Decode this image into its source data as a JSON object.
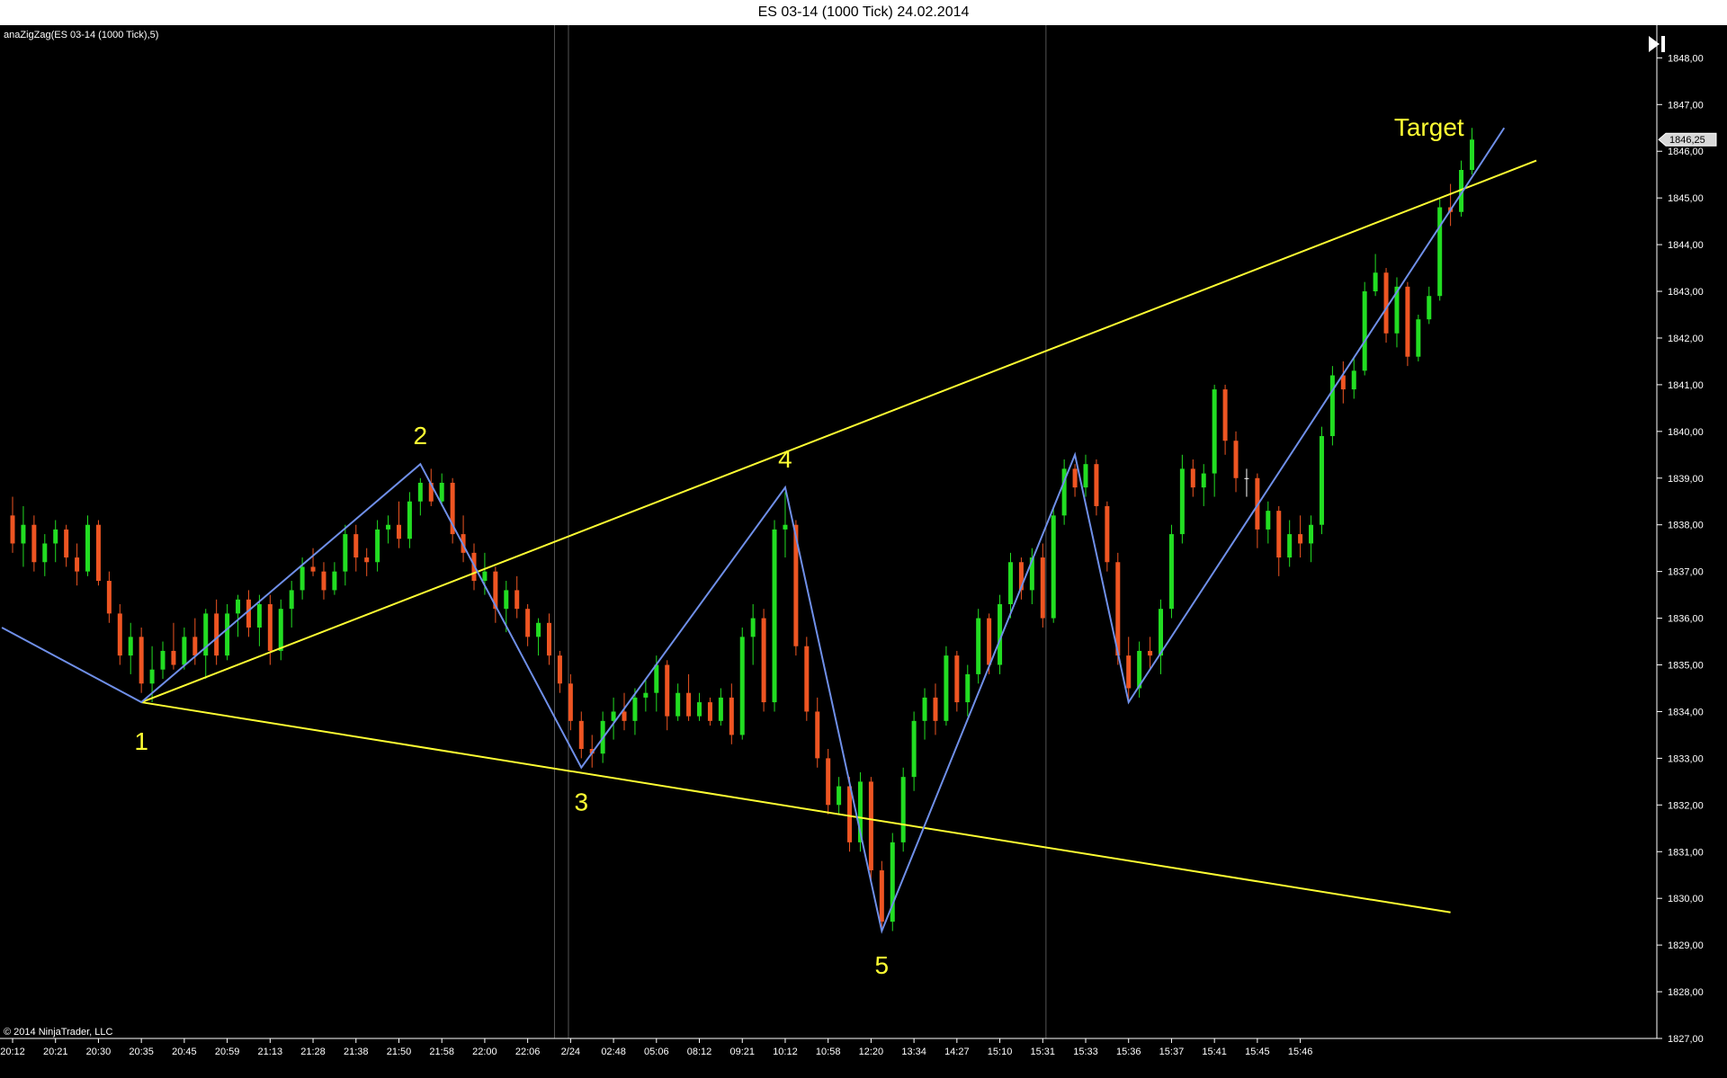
{
  "window": {
    "title": "ES 03-14 (1000 Tick)  24.02.2014"
  },
  "indicator_label": "anaZigZag(ES 03-14 (1000 Tick),5)",
  "copyright": "© 2014 NinjaTrader, LLC",
  "toolbar": {
    "end_icon": "skip-to-end-icon"
  },
  "colors": {
    "background": "#000000",
    "up_bar": "#22dd22",
    "down_bar": "#ee5522",
    "neutral_bar": "#ffffff",
    "zigzag": "#6f8fe8",
    "channel": "#ffff33",
    "label": "#ffff33",
    "axis_text": "#ffffff",
    "session_line": "#555555"
  },
  "chart_data": {
    "type": "candlestick",
    "instrument": "ES 03-14",
    "interval": "1000 Tick",
    "ylim": [
      1827,
      1848.7
    ],
    "y_ticks": [
      "1827,00",
      "1828,00",
      "1829,00",
      "1830,00",
      "1831,00",
      "1832,00",
      "1833,00",
      "1834,00",
      "1835,00",
      "1836,00",
      "1837,00",
      "1838,00",
      "1839,00",
      "1840,00",
      "1841,00",
      "1842,00",
      "1843,00",
      "1844,00",
      "1845,00",
      "1846,00",
      "1847,00",
      "1848,00"
    ],
    "x_ticks": [
      "20:12",
      "20:21",
      "20:30",
      "20:35",
      "20:45",
      "20:59",
      "21:13",
      "21:28",
      "21:38",
      "21:50",
      "21:58",
      "22:00",
      "22:06",
      "2/24",
      "02:48",
      "05:06",
      "08:12",
      "09:21",
      "10:12",
      "10:58",
      "12:20",
      "13:34",
      "14:27",
      "15:10",
      "15:31",
      "15:33",
      "15:36",
      "15:37",
      "15:41",
      "15:45",
      "15:46"
    ],
    "x_tick_bars": [
      0,
      4,
      8,
      12,
      16,
      20,
      24,
      28,
      32,
      36,
      40,
      44,
      48,
      52,
      56,
      60,
      64,
      68,
      72,
      76,
      80,
      84,
      88,
      92,
      96,
      100,
      104,
      108,
      112,
      116,
      120
    ],
    "session_breaks": [
      50.5,
      51.8,
      96.3
    ],
    "last_price": "1846,25",
    "bars": [
      {
        "o": 1838.2,
        "h": 1838.6,
        "l": 1837.4,
        "c": 1837.6
      },
      {
        "o": 1837.6,
        "h": 1838.4,
        "l": 1837.1,
        "c": 1838.0
      },
      {
        "o": 1838.0,
        "h": 1838.2,
        "l": 1837.0,
        "c": 1837.2
      },
      {
        "o": 1837.2,
        "h": 1837.8,
        "l": 1836.9,
        "c": 1837.6
      },
      {
        "o": 1837.6,
        "h": 1838.1,
        "l": 1837.2,
        "c": 1837.9
      },
      {
        "o": 1837.9,
        "h": 1838.0,
        "l": 1837.1,
        "c": 1837.3
      },
      {
        "o": 1837.3,
        "h": 1837.6,
        "l": 1836.7,
        "c": 1837.0
      },
      {
        "o": 1837.0,
        "h": 1838.2,
        "l": 1836.9,
        "c": 1838.0
      },
      {
        "o": 1838.0,
        "h": 1838.1,
        "l": 1836.7,
        "c": 1836.8
      },
      {
        "o": 1836.8,
        "h": 1837.0,
        "l": 1835.9,
        "c": 1836.1
      },
      {
        "o": 1836.1,
        "h": 1836.3,
        "l": 1835.0,
        "c": 1835.2
      },
      {
        "o": 1835.2,
        "h": 1835.9,
        "l": 1834.8,
        "c": 1835.6
      },
      {
        "o": 1835.6,
        "h": 1835.8,
        "l": 1834.4,
        "c": 1834.6
      },
      {
        "o": 1834.6,
        "h": 1835.4,
        "l": 1834.2,
        "c": 1834.9
      },
      {
        "o": 1834.9,
        "h": 1835.5,
        "l": 1834.7,
        "c": 1835.3
      },
      {
        "o": 1835.3,
        "h": 1835.9,
        "l": 1834.9,
        "c": 1835.0
      },
      {
        "o": 1835.0,
        "h": 1835.8,
        "l": 1834.9,
        "c": 1835.6
      },
      {
        "o": 1835.6,
        "h": 1836.0,
        "l": 1835.0,
        "c": 1835.2
      },
      {
        "o": 1835.2,
        "h": 1836.2,
        "l": 1834.7,
        "c": 1836.1
      },
      {
        "o": 1836.1,
        "h": 1836.4,
        "l": 1835.0,
        "c": 1835.2
      },
      {
        "o": 1835.2,
        "h": 1836.3,
        "l": 1835.1,
        "c": 1836.1
      },
      {
        "o": 1836.1,
        "h": 1836.5,
        "l": 1835.6,
        "c": 1836.4
      },
      {
        "o": 1836.4,
        "h": 1836.6,
        "l": 1835.6,
        "c": 1835.8
      },
      {
        "o": 1835.8,
        "h": 1836.5,
        "l": 1835.4,
        "c": 1836.3
      },
      {
        "o": 1836.3,
        "h": 1836.5,
        "l": 1835.0,
        "c": 1835.3
      },
      {
        "o": 1835.3,
        "h": 1836.4,
        "l": 1835.1,
        "c": 1836.2
      },
      {
        "o": 1836.2,
        "h": 1836.8,
        "l": 1835.8,
        "c": 1836.6
      },
      {
        "o": 1836.6,
        "h": 1837.3,
        "l": 1836.4,
        "c": 1837.1
      },
      {
        "o": 1837.1,
        "h": 1837.5,
        "l": 1836.9,
        "c": 1837.0
      },
      {
        "o": 1837.0,
        "h": 1837.2,
        "l": 1836.4,
        "c": 1836.6
      },
      {
        "o": 1836.6,
        "h": 1837.2,
        "l": 1836.5,
        "c": 1837.0
      },
      {
        "o": 1837.0,
        "h": 1838.0,
        "l": 1836.7,
        "c": 1837.8
      },
      {
        "o": 1837.8,
        "h": 1838.0,
        "l": 1837.0,
        "c": 1837.3
      },
      {
        "o": 1837.3,
        "h": 1837.5,
        "l": 1836.9,
        "c": 1837.2
      },
      {
        "o": 1837.2,
        "h": 1838.1,
        "l": 1837.0,
        "c": 1837.9
      },
      {
        "o": 1837.9,
        "h": 1838.2,
        "l": 1837.6,
        "c": 1838.0
      },
      {
        "o": 1838.0,
        "h": 1838.5,
        "l": 1837.5,
        "c": 1837.7
      },
      {
        "o": 1837.7,
        "h": 1838.7,
        "l": 1837.5,
        "c": 1838.5
      },
      {
        "o": 1838.5,
        "h": 1839.0,
        "l": 1838.2,
        "c": 1838.9
      },
      {
        "o": 1838.9,
        "h": 1839.2,
        "l": 1838.4,
        "c": 1838.5
      },
      {
        "o": 1838.5,
        "h": 1839.1,
        "l": 1838.4,
        "c": 1838.9
      },
      {
        "o": 1838.9,
        "h": 1839.0,
        "l": 1837.6,
        "c": 1837.8
      },
      {
        "o": 1837.8,
        "h": 1838.2,
        "l": 1837.2,
        "c": 1837.4
      },
      {
        "o": 1837.4,
        "h": 1837.6,
        "l": 1836.6,
        "c": 1836.8
      },
      {
        "o": 1836.8,
        "h": 1837.4,
        "l": 1836.5,
        "c": 1837.0
      },
      {
        "o": 1837.0,
        "h": 1837.1,
        "l": 1835.9,
        "c": 1836.2
      },
      {
        "o": 1836.2,
        "h": 1836.8,
        "l": 1835.7,
        "c": 1836.6
      },
      {
        "o": 1836.6,
        "h": 1836.9,
        "l": 1836.0,
        "c": 1836.2
      },
      {
        "o": 1836.2,
        "h": 1836.3,
        "l": 1835.4,
        "c": 1835.6
      },
      {
        "o": 1835.6,
        "h": 1836.0,
        "l": 1835.2,
        "c": 1835.9
      },
      {
        "o": 1835.9,
        "h": 1836.1,
        "l": 1835.0,
        "c": 1835.2
      },
      {
        "o": 1835.2,
        "h": 1835.3,
        "l": 1834.4,
        "c": 1834.6
      },
      {
        "o": 1834.6,
        "h": 1834.8,
        "l": 1833.6,
        "c": 1833.8
      },
      {
        "o": 1833.8,
        "h": 1834.0,
        "l": 1833.0,
        "c": 1833.2
      },
      {
        "o": 1833.2,
        "h": 1833.5,
        "l": 1832.8,
        "c": 1833.1
      },
      {
        "o": 1833.1,
        "h": 1834.0,
        "l": 1832.9,
        "c": 1833.8
      },
      {
        "o": 1833.8,
        "h": 1834.3,
        "l": 1833.4,
        "c": 1834.0
      },
      {
        "o": 1834.0,
        "h": 1834.4,
        "l": 1833.6,
        "c": 1833.8
      },
      {
        "o": 1833.8,
        "h": 1834.5,
        "l": 1833.5,
        "c": 1834.3
      },
      {
        "o": 1834.3,
        "h": 1834.7,
        "l": 1834.0,
        "c": 1834.4
      },
      {
        "o": 1834.4,
        "h": 1835.2,
        "l": 1834.0,
        "c": 1835.0
      },
      {
        "o": 1835.0,
        "h": 1835.1,
        "l": 1833.6,
        "c": 1833.9
      },
      {
        "o": 1833.9,
        "h": 1834.6,
        "l": 1833.8,
        "c": 1834.4
      },
      {
        "o": 1834.4,
        "h": 1834.8,
        "l": 1833.8,
        "c": 1833.9
      },
      {
        "o": 1833.9,
        "h": 1834.4,
        "l": 1833.8,
        "c": 1834.2
      },
      {
        "o": 1834.2,
        "h": 1834.3,
        "l": 1833.7,
        "c": 1833.8
      },
      {
        "o": 1833.8,
        "h": 1834.5,
        "l": 1833.7,
        "c": 1834.3
      },
      {
        "o": 1834.3,
        "h": 1834.6,
        "l": 1833.3,
        "c": 1833.5
      },
      {
        "o": 1833.5,
        "h": 1835.8,
        "l": 1833.4,
        "c": 1835.6
      },
      {
        "o": 1835.6,
        "h": 1836.3,
        "l": 1835.0,
        "c": 1836.0
      },
      {
        "o": 1836.0,
        "h": 1836.2,
        "l": 1834.0,
        "c": 1834.2
      },
      {
        "o": 1834.2,
        "h": 1838.1,
        "l": 1834.0,
        "c": 1837.9
      },
      {
        "o": 1837.9,
        "h": 1838.7,
        "l": 1837.3,
        "c": 1838.0
      },
      {
        "o": 1838.0,
        "h": 1838.1,
        "l": 1835.2,
        "c": 1835.4
      },
      {
        "o": 1835.4,
        "h": 1835.6,
        "l": 1833.8,
        "c": 1834.0
      },
      {
        "o": 1834.0,
        "h": 1834.3,
        "l": 1832.8,
        "c": 1833.0
      },
      {
        "o": 1833.0,
        "h": 1833.2,
        "l": 1831.8,
        "c": 1832.0
      },
      {
        "o": 1832.0,
        "h": 1832.6,
        "l": 1831.8,
        "c": 1832.4
      },
      {
        "o": 1832.4,
        "h": 1832.6,
        "l": 1831.0,
        "c": 1831.2
      },
      {
        "o": 1831.2,
        "h": 1832.7,
        "l": 1831.0,
        "c": 1832.5
      },
      {
        "o": 1832.5,
        "h": 1832.6,
        "l": 1830.4,
        "c": 1830.6
      },
      {
        "o": 1830.6,
        "h": 1830.8,
        "l": 1829.3,
        "c": 1829.5
      },
      {
        "o": 1829.5,
        "h": 1831.4,
        "l": 1829.3,
        "c": 1831.2
      },
      {
        "o": 1831.2,
        "h": 1832.8,
        "l": 1831.0,
        "c": 1832.6
      },
      {
        "o": 1832.6,
        "h": 1834.0,
        "l": 1832.3,
        "c": 1833.8
      },
      {
        "o": 1833.8,
        "h": 1834.5,
        "l": 1833.4,
        "c": 1834.3
      },
      {
        "o": 1834.3,
        "h": 1834.6,
        "l": 1833.5,
        "c": 1833.8
      },
      {
        "o": 1833.8,
        "h": 1835.4,
        "l": 1833.7,
        "c": 1835.2
      },
      {
        "o": 1835.2,
        "h": 1835.3,
        "l": 1834.0,
        "c": 1834.2
      },
      {
        "o": 1834.2,
        "h": 1835.0,
        "l": 1833.9,
        "c": 1834.8
      },
      {
        "o": 1834.8,
        "h": 1836.2,
        "l": 1834.6,
        "c": 1836.0
      },
      {
        "o": 1836.0,
        "h": 1836.1,
        "l": 1834.8,
        "c": 1835.0
      },
      {
        "o": 1835.0,
        "h": 1836.5,
        "l": 1834.8,
        "c": 1836.3
      },
      {
        "o": 1836.3,
        "h": 1837.4,
        "l": 1836.0,
        "c": 1837.2
      },
      {
        "o": 1837.2,
        "h": 1837.3,
        "l": 1836.4,
        "c": 1836.6
      },
      {
        "o": 1836.6,
        "h": 1837.5,
        "l": 1836.3,
        "c": 1837.3
      },
      {
        "o": 1837.3,
        "h": 1837.6,
        "l": 1835.8,
        "c": 1836.0
      },
      {
        "o": 1836.0,
        "h": 1838.4,
        "l": 1835.9,
        "c": 1838.2
      },
      {
        "o": 1838.2,
        "h": 1839.4,
        "l": 1838.0,
        "c": 1839.2
      },
      {
        "o": 1839.2,
        "h": 1839.3,
        "l": 1838.6,
        "c": 1838.8
      },
      {
        "o": 1838.8,
        "h": 1839.5,
        "l": 1838.6,
        "c": 1839.3
      },
      {
        "o": 1839.3,
        "h": 1839.4,
        "l": 1838.2,
        "c": 1838.4
      },
      {
        "o": 1838.4,
        "h": 1838.5,
        "l": 1837.0,
        "c": 1837.2
      },
      {
        "o": 1837.2,
        "h": 1837.4,
        "l": 1835.0,
        "c": 1835.2
      },
      {
        "o": 1835.2,
        "h": 1835.6,
        "l": 1834.2,
        "c": 1834.5
      },
      {
        "o": 1834.5,
        "h": 1835.5,
        "l": 1834.3,
        "c": 1835.3
      },
      {
        "o": 1835.3,
        "h": 1835.6,
        "l": 1834.9,
        "c": 1835.2
      },
      {
        "o": 1835.2,
        "h": 1836.4,
        "l": 1834.8,
        "c": 1836.2
      },
      {
        "o": 1836.2,
        "h": 1838.0,
        "l": 1836.0,
        "c": 1837.8
      },
      {
        "o": 1837.8,
        "h": 1839.5,
        "l": 1837.6,
        "c": 1839.2
      },
      {
        "o": 1839.2,
        "h": 1839.4,
        "l": 1838.6,
        "c": 1838.8
      },
      {
        "o": 1838.8,
        "h": 1839.3,
        "l": 1838.4,
        "c": 1839.1
      },
      {
        "o": 1839.1,
        "h": 1841.0,
        "l": 1838.6,
        "c": 1840.9
      },
      {
        "o": 1840.9,
        "h": 1841.0,
        "l": 1839.5,
        "c": 1839.8
      },
      {
        "o": 1839.8,
        "h": 1840.0,
        "l": 1838.7,
        "c": 1839.0
      },
      {
        "o": 1839.0,
        "h": 1839.2,
        "l": 1838.6,
        "c": 1839.0
      },
      {
        "o": 1839.0,
        "h": 1839.1,
        "l": 1837.5,
        "c": 1837.9
      },
      {
        "o": 1837.9,
        "h": 1838.5,
        "l": 1837.6,
        "c": 1838.3
      },
      {
        "o": 1838.3,
        "h": 1838.4,
        "l": 1836.9,
        "c": 1837.3
      },
      {
        "o": 1837.3,
        "h": 1838.1,
        "l": 1837.1,
        "c": 1837.8
      },
      {
        "o": 1837.8,
        "h": 1838.2,
        "l": 1837.3,
        "c": 1837.6
      },
      {
        "o": 1837.6,
        "h": 1838.2,
        "l": 1837.2,
        "c": 1838.0
      },
      {
        "o": 1838.0,
        "h": 1840.1,
        "l": 1837.8,
        "c": 1839.9
      },
      {
        "o": 1839.9,
        "h": 1841.4,
        "l": 1839.7,
        "c": 1841.2
      },
      {
        "o": 1841.2,
        "h": 1841.5,
        "l": 1840.6,
        "c": 1840.9
      },
      {
        "o": 1840.9,
        "h": 1841.6,
        "l": 1840.7,
        "c": 1841.3
      },
      {
        "o": 1841.3,
        "h": 1843.2,
        "l": 1841.2,
        "c": 1843.0
      },
      {
        "o": 1843.0,
        "h": 1843.8,
        "l": 1842.9,
        "c": 1843.4
      },
      {
        "o": 1843.4,
        "h": 1843.5,
        "l": 1841.9,
        "c": 1842.1
      },
      {
        "o": 1842.1,
        "h": 1843.3,
        "l": 1841.8,
        "c": 1843.1
      },
      {
        "o": 1843.1,
        "h": 1843.2,
        "l": 1841.4,
        "c": 1841.6
      },
      {
        "o": 1841.6,
        "h": 1842.5,
        "l": 1841.5,
        "c": 1842.4
      },
      {
        "o": 1842.4,
        "h": 1843.1,
        "l": 1842.3,
        "c": 1842.9
      },
      {
        "o": 1842.9,
        "h": 1845.0,
        "l": 1842.8,
        "c": 1844.8
      },
      {
        "o": 1844.8,
        "h": 1845.3,
        "l": 1844.4,
        "c": 1844.7
      },
      {
        "o": 1844.7,
        "h": 1845.8,
        "l": 1844.6,
        "c": 1845.6
      },
      {
        "o": 1845.6,
        "h": 1846.5,
        "l": 1845.5,
        "c": 1846.25
      }
    ],
    "zigzag": [
      {
        "bar": -1,
        "price": 1835.8
      },
      {
        "bar": 12,
        "price": 1834.2
      },
      {
        "bar": 38,
        "price": 1839.3
      },
      {
        "bar": 53,
        "price": 1832.8
      },
      {
        "bar": 72,
        "price": 1838.8
      },
      {
        "bar": 81,
        "price": 1829.3
      },
      {
        "bar": 99,
        "price": 1839.5
      },
      {
        "bar": 104,
        "price": 1834.2
      },
      {
        "bar": 139,
        "price": 1846.5
      }
    ],
    "channel_lines": [
      {
        "from": {
          "bar": 12,
          "price": 1834.2
        },
        "to": {
          "bar": 142,
          "price": 1845.8
        }
      },
      {
        "from": {
          "bar": 12,
          "price": 1834.2
        },
        "to": {
          "bar": 134,
          "price": 1829.7
        }
      }
    ],
    "annotations": [
      {
        "text": "1",
        "bar": 12,
        "price": 1833.8,
        "anchor": "below"
      },
      {
        "text": "2",
        "bar": 38,
        "price": 1839.5,
        "anchor": "above"
      },
      {
        "text": "3",
        "bar": 53,
        "price": 1832.5,
        "anchor": "below"
      },
      {
        "text": "4",
        "bar": 72,
        "price": 1839.0,
        "anchor": "above"
      },
      {
        "text": "5",
        "bar": 81,
        "price": 1829.0,
        "anchor": "below"
      },
      {
        "text": "Target",
        "bar": 132,
        "price": 1846.1,
        "anchor": "above"
      }
    ]
  }
}
